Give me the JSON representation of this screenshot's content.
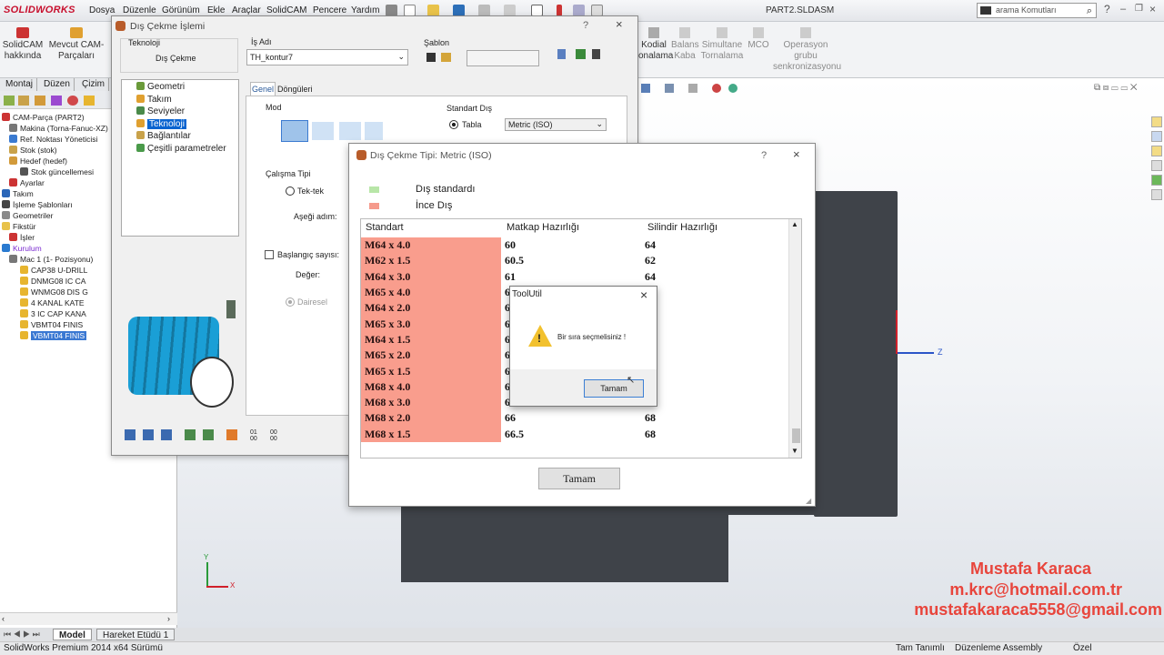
{
  "app": {
    "logo_text": "SOLIDWORKS",
    "document_title": "PART2.SLDASM",
    "menu": [
      "Dosya",
      "Düzenle",
      "Görünüm",
      "Ekle",
      "Araçlar",
      "SolidCAM",
      "Pencere",
      "Yardım"
    ],
    "search_placeholder": "arama Komutları"
  },
  "ribbon": {
    "left_buttons": [
      {
        "label": "SolidCAM hakkında"
      },
      {
        "label": "Mevcut CAM-Parçaları"
      }
    ],
    "right_buttons": [
      {
        "label": "Kodial onalama",
        "grey": false
      },
      {
        "label": "Balans Kaba",
        "grey": true
      },
      {
        "label": "Simultane Tornalama",
        "grey": true
      },
      {
        "label": "MCO",
        "grey": true
      },
      {
        "label": "Operasyon grubu senkronizasyonu",
        "grey": true
      }
    ]
  },
  "tree": {
    "tabs": [
      "Montaj",
      "Düzen",
      "Çizim"
    ],
    "items": [
      {
        "label": "CAM-Parça (PART2)",
        "depth": 0
      },
      {
        "label": "Makina (Torna-Fanuc-XZ)",
        "depth": 1
      },
      {
        "label": "Ref. Noktası Yöneticisi",
        "depth": 1
      },
      {
        "label": "Stok (stok)",
        "depth": 1
      },
      {
        "label": "Hedef (hedef)",
        "depth": 1
      },
      {
        "label": "Stok güncellemesi",
        "depth": 2
      },
      {
        "label": "Ayarlar",
        "depth": 1
      },
      {
        "label": "Takım",
        "depth": 0
      },
      {
        "label": "İşleme Şablonları",
        "depth": 0
      },
      {
        "label": "Geometriler",
        "depth": 0
      },
      {
        "label": "Fikstür",
        "depth": 0
      },
      {
        "label": "İşler",
        "depth": 1
      },
      {
        "label": "Kurulum",
        "depth": 0
      },
      {
        "label": "Mac 1 (1- Pozisyonu)",
        "depth": 1
      },
      {
        "label": "CAP38 U-DRILL",
        "depth": 2
      },
      {
        "label": "DNMG08 IC CA",
        "depth": 2
      },
      {
        "label": "WNMG08 DIS G",
        "depth": 2
      },
      {
        "label": "4 KANAL KATE",
        "depth": 2
      },
      {
        "label": "3 IC CAP KANA",
        "depth": 2
      },
      {
        "label": "VBMT04 FINIS",
        "depth": 2
      },
      {
        "label": "VBMT04 FINIS",
        "depth": 2,
        "selected": true
      }
    ]
  },
  "sheet_tabs": [
    "Model",
    "Hareket Etüdü 1"
  ],
  "status": {
    "left": "SolidWorks Premium 2014 x64 Sürümü",
    "mid": "Tam Tanımlı",
    "mid2": "Düzenleme Assembly",
    "right": "Özel"
  },
  "dialog_main": {
    "title": "Dış Çekme İşlemi",
    "help": "?",
    "close": "×",
    "technology_label": "Teknoloji",
    "technology_value": "Dış Çekme",
    "job_name_label": "İş Adı",
    "job_name_value": "TH_kontur7",
    "template_label": "Şablon",
    "nav_items": [
      "Geometri",
      "Takım",
      "Seviyeler",
      "Teknoloji",
      "Bağlantılar",
      "Çeşitli parametreler"
    ],
    "nav_selected": "Teknoloji",
    "tabs": [
      "Genel",
      "Döngüleri"
    ],
    "mode_label": "Mod",
    "standard_label": "Standart Dış",
    "table_radio": "Tabla",
    "table_select": "Metric (ISO)",
    "work_type_label": "Çalışma Tipi",
    "single_radio": "Tek-tek",
    "down_step_label": "Aşeği adım:",
    "start_count_label": "Başlangıç sayısı:",
    "value_label": "Değer:",
    "circular_radio": "Dairesel"
  },
  "dialog_table": {
    "title": "Dış Çekme Tipi: Metric (ISO)",
    "help": "?",
    "close": "×",
    "legend": [
      {
        "label": "Dış standardı",
        "color": "#b8e6a8"
      },
      {
        "label": "İnce Dış",
        "color": "#f59a8c"
      }
    ],
    "columns": [
      "Standart",
      "Matkap Hazırlığı",
      "Silindir Hazırlığı"
    ],
    "rows": [
      [
        "M64 x 4.0",
        "60",
        "64"
      ],
      [
        "M62 x 1.5",
        "60.5",
        "62"
      ],
      [
        "M64 x 3.0",
        "61",
        "64"
      ],
      [
        "M65 x 4.0",
        "61",
        "65"
      ],
      [
        "M64 x 2.0",
        "62",
        "64"
      ],
      [
        "M65 x 3.0",
        "62",
        "65"
      ],
      [
        "M64 x 1.5",
        "62.5",
        "64"
      ],
      [
        "M65 x 2.0",
        "63",
        "65"
      ],
      [
        "M65 x 1.5",
        "63.5",
        "65"
      ],
      [
        "M68 x 4.0",
        "64",
        "68"
      ],
      [
        "M68 x 3.0",
        "65",
        "68"
      ],
      [
        "M68 x 2.0",
        "66",
        "68"
      ],
      [
        "M68 x 1.5",
        "66.5",
        "68"
      ]
    ],
    "ok_button": "Tamam"
  },
  "dialog_msg": {
    "title": "ToolUtil",
    "close": "×",
    "message": "Bir sıra seçmelisiniz !",
    "ok_button": "Tamam"
  },
  "watermark": {
    "name": "Mustafa Karaca",
    "email1": "m.krc@hotmail.com.tr",
    "email2": "mustafakaraca5558@gmail.com"
  },
  "axes": {
    "y": "Y",
    "x": "X",
    "z": "Z"
  }
}
